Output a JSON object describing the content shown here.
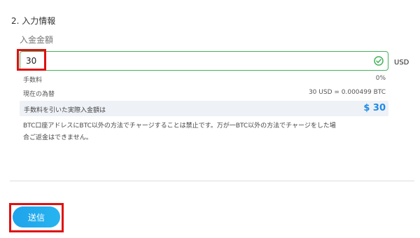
{
  "form": {
    "section_title": "2. 入力情報",
    "amount_label": "入金金額",
    "amount_value": "30",
    "currency": "USD",
    "fee_label": "手数料",
    "fee_value": "0%",
    "rate_label": "現在の為替",
    "rate_value": "30 USD = 0.000499 BTC",
    "net_label": "手数料を引いた実際入金額は",
    "net_value": "$ 30",
    "notice_line1": "BTC口座アドレスにBTC以外の方法でチャージすることは禁止です。万が一BTC以外の方法でチャージをした場",
    "notice_line2": "合ご返金はできません。",
    "submit_label": "送信"
  },
  "colors": {
    "valid_border": "#43b25a",
    "accent_blue": "#1e8be6",
    "highlight_red": "#e01010",
    "net_row_bg": "#eef1f6"
  },
  "icons": {
    "valid": "check-circle-icon"
  }
}
